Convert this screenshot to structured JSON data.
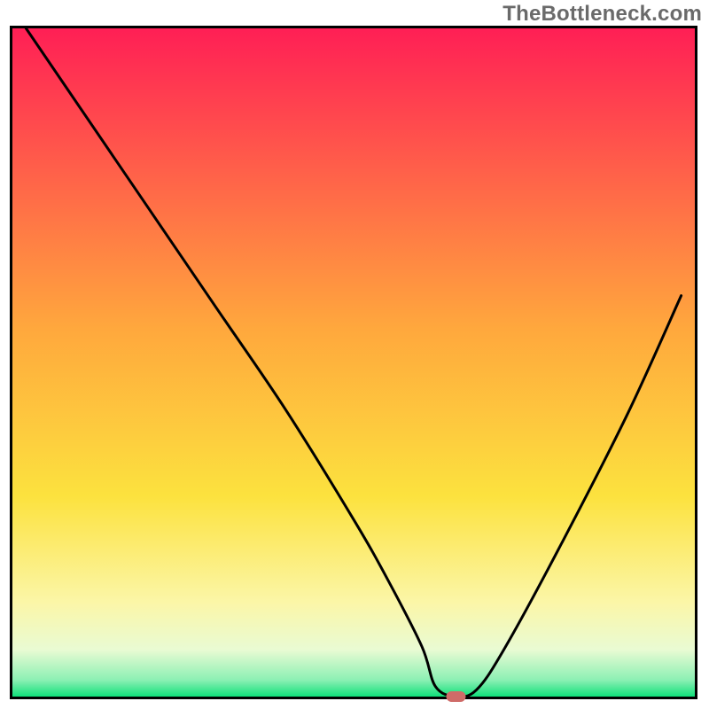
{
  "watermark": "TheBottleneck.com",
  "chart_data": {
    "type": "line",
    "title": "",
    "xlabel": "",
    "ylabel": "",
    "xlim": [
      0,
      100
    ],
    "ylim": [
      0,
      100
    ],
    "x": [
      2,
      10,
      20,
      30,
      40,
      50,
      55,
      60,
      62,
      65,
      68,
      72,
      80,
      90,
      98
    ],
    "values": [
      100,
      88,
      73,
      58,
      43,
      26.5,
      17.5,
      7.5,
      1.5,
      0,
      1,
      7,
      22,
      42,
      60
    ],
    "marker": {
      "x": 65,
      "y": 0
    },
    "background": {
      "stops": [
        {
          "offset": 0.0,
          "color": "#ff1f55"
        },
        {
          "offset": 0.45,
          "color": "#ffa83d"
        },
        {
          "offset": 0.7,
          "color": "#fce23e"
        },
        {
          "offset": 0.86,
          "color": "#fbf6a8"
        },
        {
          "offset": 0.93,
          "color": "#e9fbd3"
        },
        {
          "offset": 0.975,
          "color": "#8cf0b4"
        },
        {
          "offset": 1.0,
          "color": "#10e07a"
        }
      ]
    },
    "axis_color": "#000000",
    "line_color": "#000000",
    "marker_color": "#cf6b68"
  }
}
